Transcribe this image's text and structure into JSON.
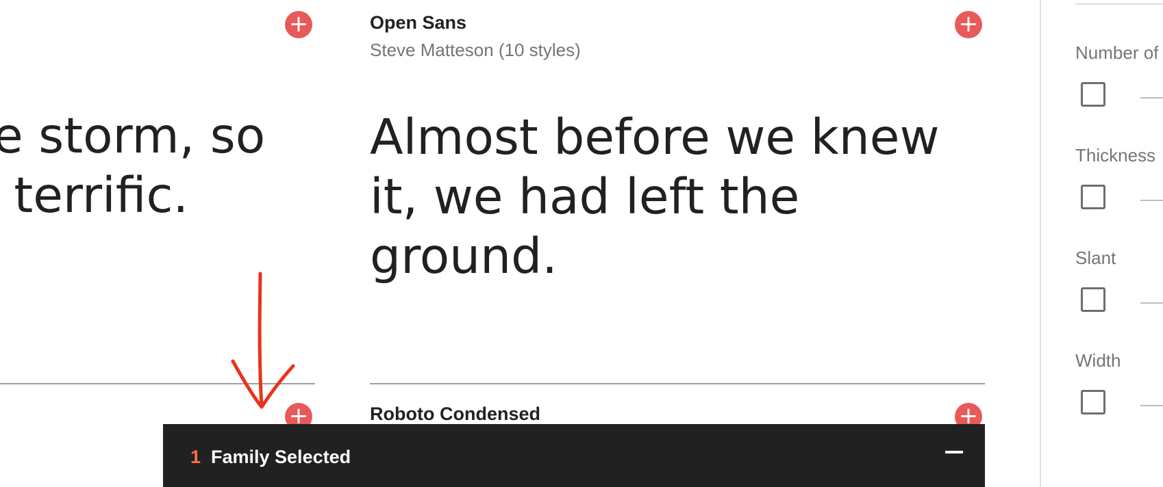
{
  "left_card": {
    "sample_lines": [
      "e storm, so",
      "t terrific."
    ]
  },
  "main_card": {
    "font_name": "Open Sans",
    "font_meta": "Steve Matteson (10 styles)",
    "sample_lines": [
      "Almost before we knew",
      "it, we had left the",
      "ground."
    ]
  },
  "next_card": {
    "font_name": "Roboto Condensed"
  },
  "add_icon_glyph": "+",
  "filters": {
    "items": [
      {
        "label": "Number of"
      },
      {
        "label": "Thickness"
      },
      {
        "label": "Slant"
      },
      {
        "label": "Width"
      }
    ]
  },
  "selection_bar": {
    "count": "1",
    "label": "Family Selected"
  },
  "colors": {
    "accent": "#e85a5a",
    "count": "#ff7043",
    "bar_bg": "#212121",
    "annotation": "#e8341c"
  }
}
